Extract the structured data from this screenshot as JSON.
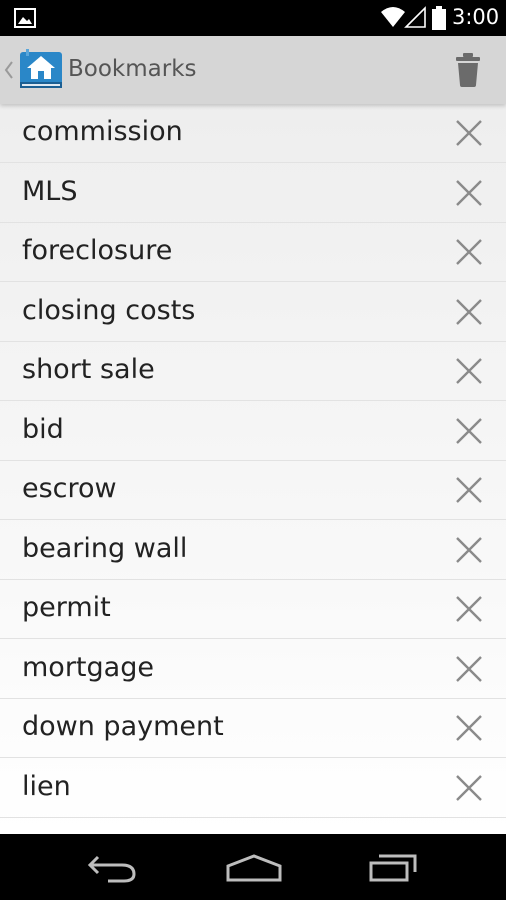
{
  "status_bar": {
    "time": "3:00",
    "icons": [
      "image-notification-icon",
      "wifi-icon",
      "cell-signal-icon",
      "battery-icon"
    ]
  },
  "action_bar": {
    "title": "Bookmarks",
    "icons": [
      "up-caret-icon",
      "app-logo-icon",
      "trash-icon"
    ]
  },
  "bookmarks": [
    {
      "label": "commission"
    },
    {
      "label": "MLS"
    },
    {
      "label": "foreclosure"
    },
    {
      "label": "closing costs"
    },
    {
      "label": "short sale"
    },
    {
      "label": "bid"
    },
    {
      "label": "escrow"
    },
    {
      "label": "bearing wall"
    },
    {
      "label": "permit"
    },
    {
      "label": "mortgage"
    },
    {
      "label": "down payment"
    },
    {
      "label": "lien"
    }
  ],
  "nav_bar": {
    "icons": [
      "back-icon",
      "home-icon",
      "recents-icon"
    ]
  },
  "colors": {
    "action_bar_bg": "#d6d6d6",
    "title_text": "#555555",
    "row_text": "#222222",
    "remove_icon": "#8a8a8a"
  }
}
